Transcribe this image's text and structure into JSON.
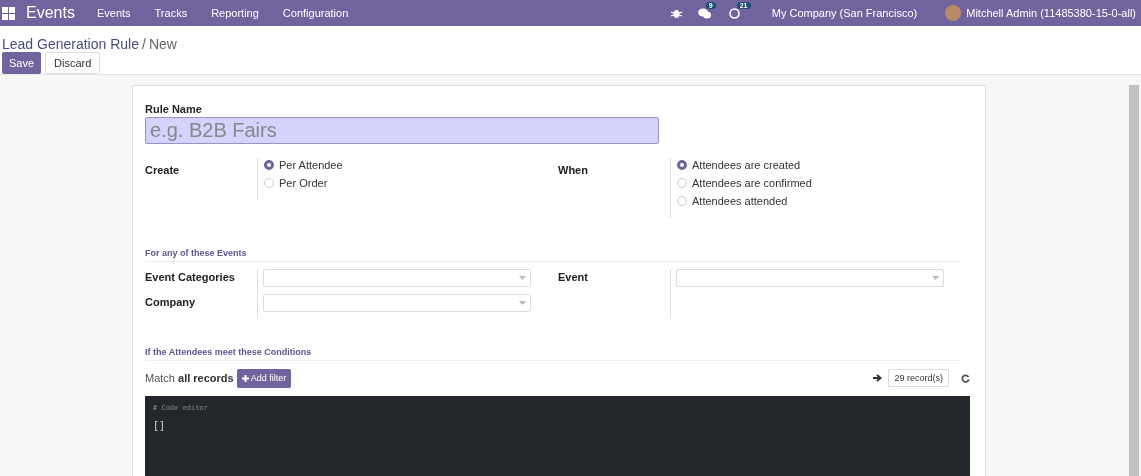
{
  "navbar": {
    "app_name": "Events",
    "menu": [
      "Events",
      "Tracks",
      "Reporting",
      "Configuration"
    ],
    "messages_count": "9",
    "activities_count": "21",
    "company": "My Company (San Francisco)",
    "user": "Mitchell Admin (11485380-15-0-all)"
  },
  "breadcrumb": {
    "parent": "Lead Generation Rule",
    "separator": "/",
    "current": "New"
  },
  "buttons": {
    "save": "Save",
    "discard": "Discard"
  },
  "form": {
    "rule_name": {
      "label": "Rule Name",
      "placeholder": "e.g. B2B Fairs"
    },
    "create": {
      "label": "Create",
      "options": [
        {
          "label": "Per Attendee",
          "selected": true
        },
        {
          "label": "Per Order",
          "selected": false
        }
      ]
    },
    "when": {
      "label": "When",
      "options": [
        {
          "label": "Attendees are created",
          "selected": true
        },
        {
          "label": "Attendees are confirmed",
          "selected": false
        },
        {
          "label": "Attendees attended",
          "selected": false
        }
      ]
    },
    "events_section": {
      "title": "For any of these Events",
      "left_fields": [
        {
          "label": "Event Categories"
        },
        {
          "label": "Company"
        }
      ],
      "right_fields": [
        {
          "label": "Event"
        }
      ]
    },
    "conditions": {
      "title": "If the Attendees meet these Conditions",
      "match_prefix": "Match",
      "match_bold": "all records",
      "add_filter": "Add filter",
      "records": "29 record(s)"
    },
    "code_editor": {
      "comment": "# Code editor",
      "value": "[]"
    }
  }
}
